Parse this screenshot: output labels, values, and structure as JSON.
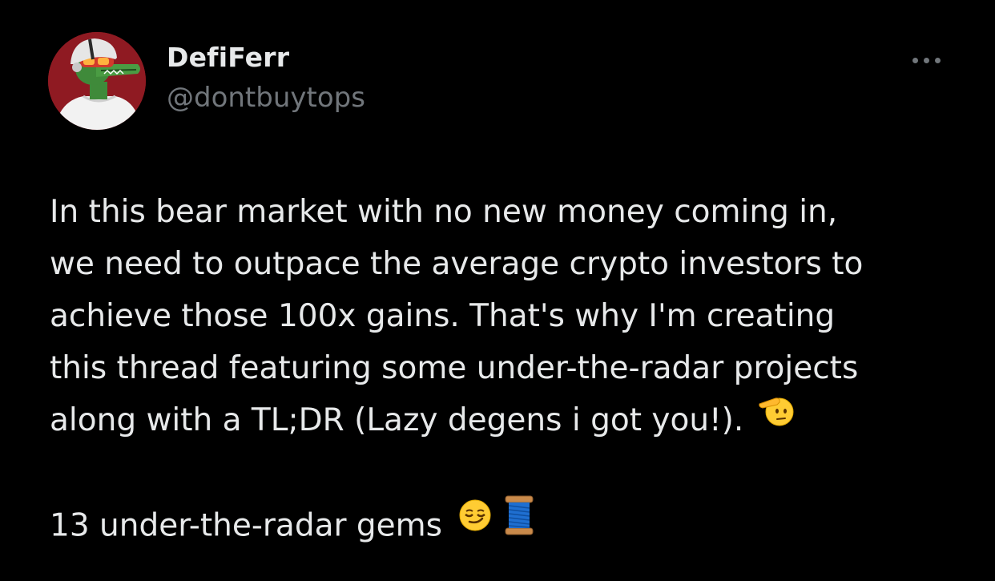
{
  "author": {
    "display_name": "DefiFerr",
    "handle": "@dontbuytops"
  },
  "tweet": {
    "lines": [
      "In this bear market with no new money coming in,",
      "we need to outpace the average crypto investors to",
      "achieve those 100x gains. That's why I'm creating",
      "this thread featuring some under-the-radar projects",
      "along with a TL;DR (Lazy degens i got you!)."
    ],
    "last_line": "13 under-the-radar gems"
  },
  "icons": {
    "more": "more-options-icon",
    "salute": "saluting-face-emoji-icon",
    "smirk": "smirking-face-emoji-icon",
    "thread": "spool-of-thread-emoji-icon"
  },
  "colors": {
    "background": "#000000",
    "primary_text": "#e7e9ea",
    "secondary_text": "#71767b",
    "avatar_bg": "#8f1a22"
  }
}
